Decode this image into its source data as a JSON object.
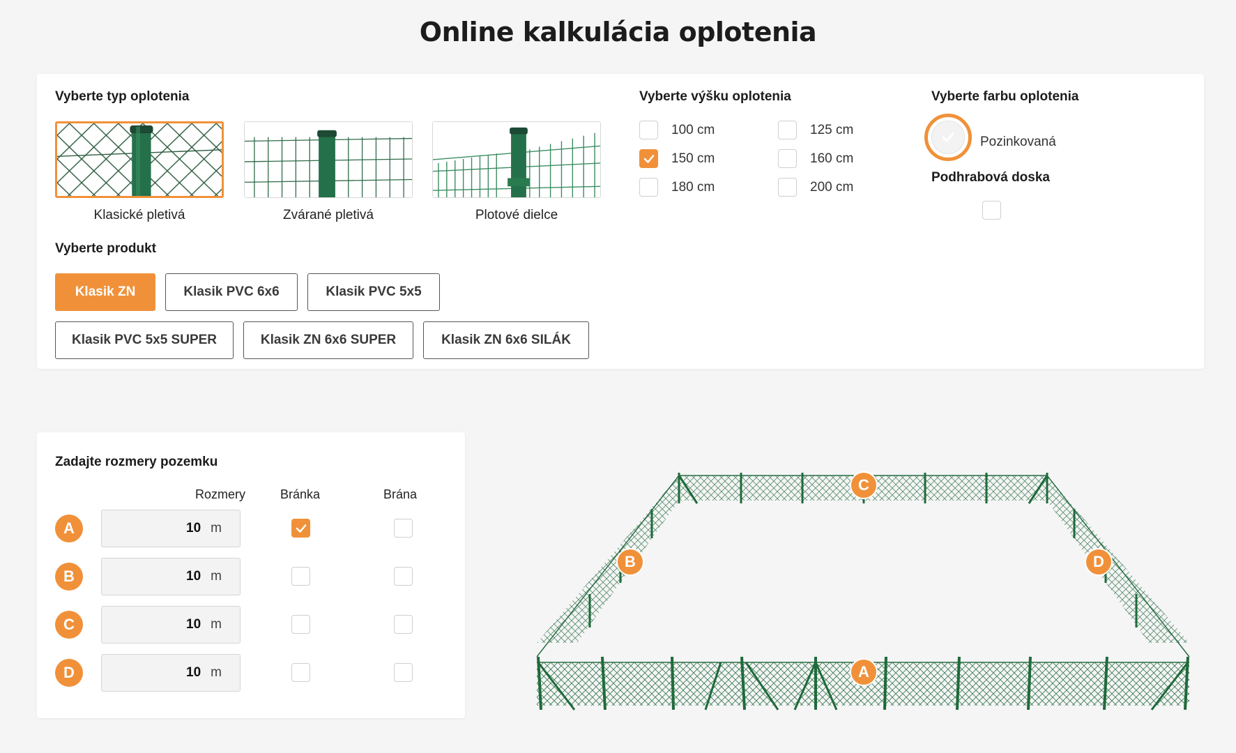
{
  "title": "Online kalkulácia oplotenia",
  "fence_type": {
    "heading": "Vyberte typ oplotenia",
    "options": [
      "Klasické pletivá",
      "Zvárané pletivá",
      "Plotové dielce"
    ],
    "selected": "Klasické pletivá"
  },
  "product": {
    "heading": "Vyberte produkt",
    "items": [
      "Klasik ZN",
      "Klasik PVC 6x6",
      "Klasik PVC 5x5",
      "Klasik PVC 5x5 SUPER",
      "Klasik ZN 6x6 SUPER",
      "Klasik ZN 6x6 SILÁK"
    ],
    "selected": "Klasik ZN"
  },
  "height": {
    "heading": "Vyberte výšku oplotenia",
    "options": [
      "100 cm",
      "125 cm",
      "150 cm",
      "160 cm",
      "180 cm",
      "200 cm"
    ],
    "selected": "150 cm"
  },
  "color": {
    "heading": "Vyberte farbu oplotenia",
    "option": "Pozinkovaná",
    "selected": true
  },
  "board": {
    "heading": "Podhrabová doska",
    "checked": false
  },
  "dimensions": {
    "heading": "Zadajte rozmery pozemku",
    "columns": [
      "Rozmery",
      "Bránka",
      "Brána"
    ],
    "unit": "m",
    "rows": [
      {
        "side": "A",
        "value": "10",
        "branka": true,
        "brana": false
      },
      {
        "side": "B",
        "value": "10",
        "branka": false,
        "brana": false
      },
      {
        "side": "C",
        "value": "10",
        "branka": false,
        "brana": false
      },
      {
        "side": "D",
        "value": "10",
        "branka": false,
        "brana": false
      }
    ]
  },
  "diagram": {
    "sides": [
      "A",
      "B",
      "C",
      "D"
    ]
  },
  "colors": {
    "accent": "#f0913a",
    "fence_green": "#2a6e43"
  }
}
